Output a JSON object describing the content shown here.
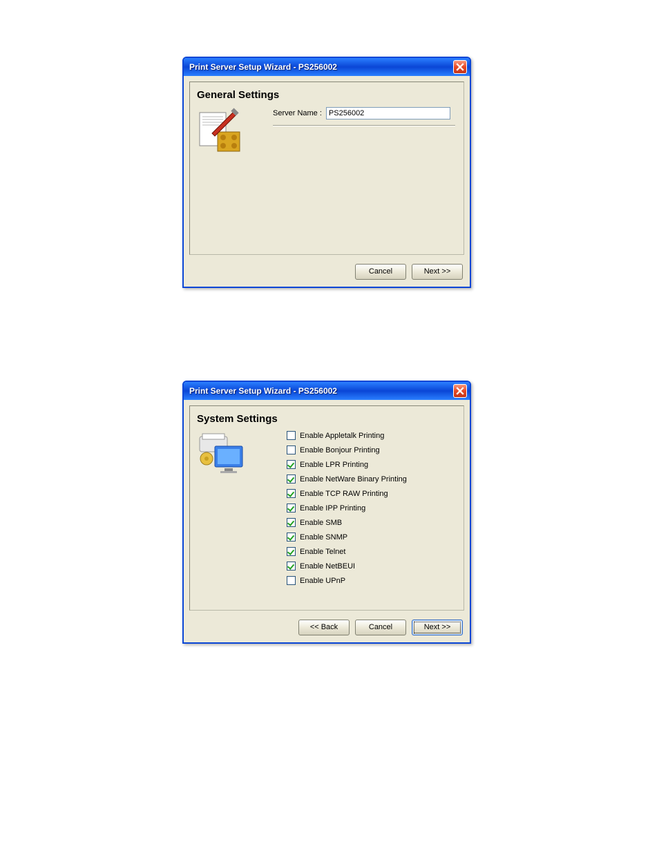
{
  "dialog1": {
    "title": "Print Server Setup Wizard - PS256002",
    "heading": "General Settings",
    "server_name_label": "Server Name :",
    "server_name_value": "PS256002",
    "buttons": {
      "cancel": "Cancel",
      "next": "Next >>"
    }
  },
  "dialog2": {
    "title": "Print Server Setup Wizard - PS256002",
    "heading": "System Settings",
    "options": [
      {
        "label": "Enable Appletalk Printing",
        "checked": false
      },
      {
        "label": "Enable Bonjour Printing",
        "checked": false
      },
      {
        "label": "Enable LPR Printing",
        "checked": true
      },
      {
        "label": "Enable NetWare Binary Printing",
        "checked": true
      },
      {
        "label": "Enable TCP RAW Printing",
        "checked": true
      },
      {
        "label": "Enable IPP Printing",
        "checked": true
      },
      {
        "label": "Enable SMB",
        "checked": true
      },
      {
        "label": "Enable SNMP",
        "checked": true
      },
      {
        "label": "Enable Telnet",
        "checked": true
      },
      {
        "label": "Enable NetBEUI",
        "checked": true
      },
      {
        "label": "Enable UPnP",
        "checked": false
      }
    ],
    "buttons": {
      "back": "<< Back",
      "cancel": "Cancel",
      "next": "Next >>"
    }
  }
}
